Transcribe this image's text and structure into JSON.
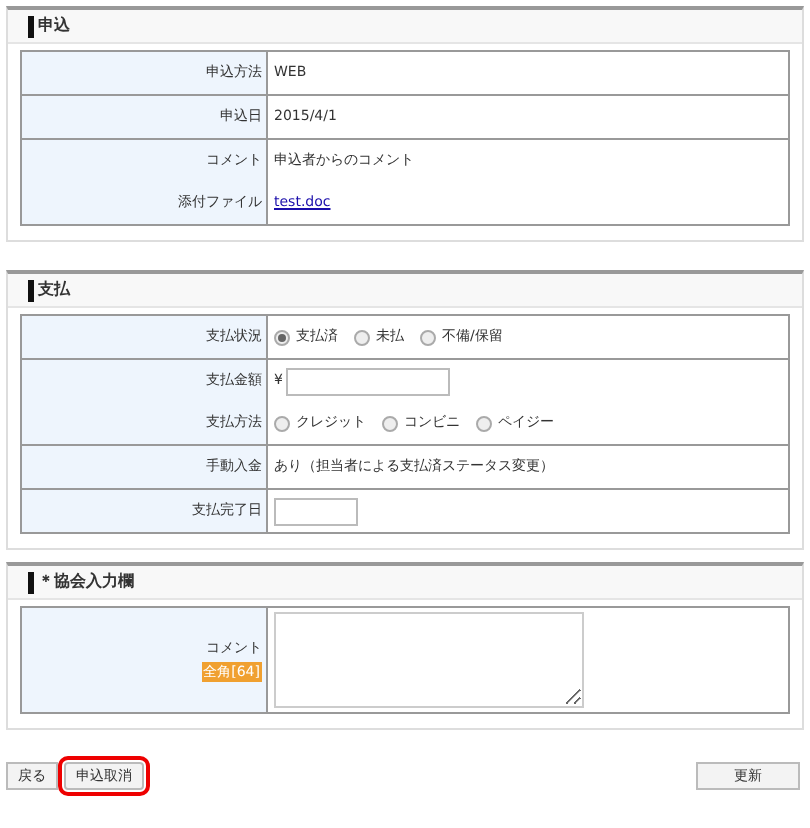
{
  "sections": [
    {
      "title": "申込",
      "rows": [
        {
          "items": [
            {
              "label": "申込方法",
              "kind": "text",
              "value": "WEB"
            }
          ]
        },
        {
          "items": [
            {
              "label": "申込日",
              "kind": "text",
              "value": "2015/4/1"
            }
          ]
        },
        {
          "items": [
            {
              "label": "コメント",
              "kind": "text",
              "value": "申込者からのコメント"
            },
            {
              "label": "添付ファイル",
              "kind": "link",
              "value": "test.doc"
            }
          ]
        }
      ]
    },
    {
      "title": "支払",
      "rows": [
        {
          "items": [
            {
              "label": "支払状況",
              "kind": "radios",
              "options": [
                {
                  "label": "支払済",
                  "selected": true
                },
                {
                  "label": "未払",
                  "selected": false
                },
                {
                  "label": "不備/保留",
                  "selected": false
                }
              ]
            }
          ]
        },
        {
          "items": [
            {
              "label": "支払金額",
              "kind": "money",
              "prefix": "¥"
            },
            {
              "label": "支払方法",
              "kind": "radios",
              "options": [
                {
                  "label": "クレジット",
                  "selected": false
                },
                {
                  "label": "コンビニ",
                  "selected": false
                },
                {
                  "label": "ペイジー",
                  "selected": false
                }
              ]
            }
          ]
        },
        {
          "items": [
            {
              "label": "手動入金",
              "kind": "text",
              "value": "あり（担当者による支払済ステータス変更）"
            }
          ]
        },
        {
          "items": [
            {
              "label": "支払完了日",
              "kind": "input"
            }
          ]
        }
      ]
    },
    {
      "title": "＊協会入力欄",
      "rows": [
        {
          "items": [
            {
              "label": "コメント",
              "kind": "textarea",
              "badge": "全角[64]"
            }
          ]
        }
      ]
    }
  ],
  "buttons": [
    {
      "label": "戻る",
      "highlighted": false
    },
    {
      "label": "申込取消",
      "highlighted": true
    }
  ],
  "right_button": {
    "label": "更新"
  }
}
